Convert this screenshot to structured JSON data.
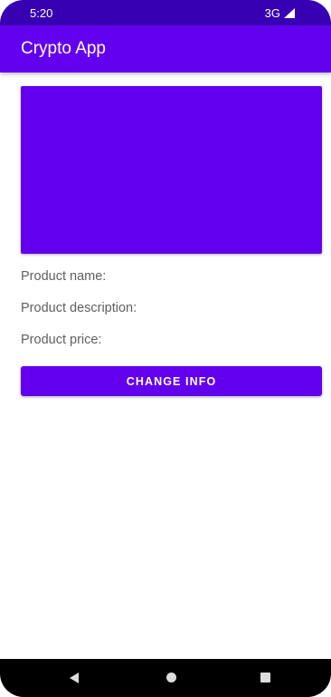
{
  "status_bar": {
    "time": "5:20",
    "network": "3G",
    "signal_icon": "signal-icon"
  },
  "app_bar": {
    "title": "Crypto App"
  },
  "product": {
    "image_color": "#6200ee",
    "name_label": "Product name:",
    "description_label": "Product description:",
    "price_label": "Product price:"
  },
  "actions": {
    "change_info_label": "CHANGE INFO"
  },
  "nav_bar": {
    "back_icon": "back-icon",
    "home_icon": "home-icon",
    "recents_icon": "recents-icon"
  },
  "colors": {
    "primary": "#6200ee",
    "primary_dark": "#3700b3"
  }
}
